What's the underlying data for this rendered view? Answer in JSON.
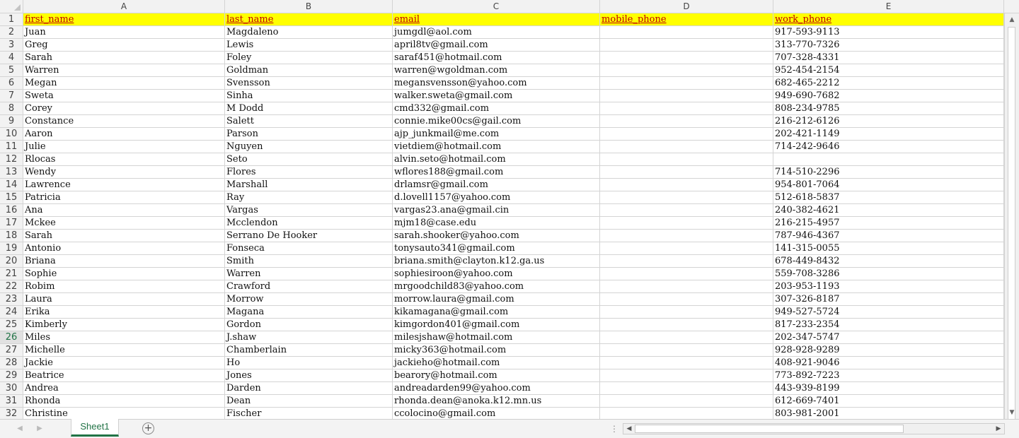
{
  "sheet": {
    "columns": [
      "A",
      "B",
      "C",
      "D",
      "E"
    ],
    "headers": [
      "first_name",
      "last_name",
      "email",
      "mobile_phone",
      "work_phone"
    ],
    "active_row": 26,
    "rows": [
      {
        "num": 1
      },
      {
        "num": 2,
        "cells": [
          "Juan",
          "Magdaleno",
          "jumgdl@aol.com",
          "",
          "917-593-9113"
        ]
      },
      {
        "num": 3,
        "cells": [
          "Greg",
          "Lewis",
          "april8tv@gmail.com",
          "",
          "313-770-7326"
        ]
      },
      {
        "num": 4,
        "cells": [
          "Sarah",
          "Foley",
          "saraf451@hotmail.com",
          "",
          "707-328-4331"
        ]
      },
      {
        "num": 5,
        "cells": [
          "Warren",
          "Goldman",
          "warren@wgoldman.com",
          "",
          "952-454-2154"
        ]
      },
      {
        "num": 6,
        "cells": [
          "Megan",
          "Svensson",
          "megansvensson@yahoo.com",
          "",
          "682-465-2212"
        ]
      },
      {
        "num": 7,
        "cells": [
          "Sweta",
          "Sinha",
          "walker.sweta@gmail.com",
          "",
          "949-690-7682"
        ]
      },
      {
        "num": 8,
        "cells": [
          "Corey",
          "M Dodd",
          "cmd332@gmail.com",
          "",
          "808-234-9785"
        ]
      },
      {
        "num": 9,
        "cells": [
          "Constance",
          "Salett",
          "connie.mike00cs@gail.com",
          "",
          "216-212-6126"
        ]
      },
      {
        "num": 10,
        "cells": [
          "Aaron",
          "Parson",
          "ajp_junkmail@me.com",
          "",
          "202-421-1149"
        ]
      },
      {
        "num": 11,
        "cells": [
          "Julie",
          "Nguyen",
          "vietdiem@hotmail.com",
          "",
          "714-242-9646"
        ]
      },
      {
        "num": 12,
        "cells": [
          "Rlocas",
          "Seto",
          "alvin.seto@hotmail.com",
          "",
          ""
        ]
      },
      {
        "num": 13,
        "cells": [
          "Wendy",
          "Flores",
          "wflores188@gmail.com",
          "",
          "714-510-2296"
        ]
      },
      {
        "num": 14,
        "cells": [
          "Lawrence",
          "Marshall",
          "drlamsr@gmail.com",
          "",
          "954-801-7064"
        ]
      },
      {
        "num": 15,
        "cells": [
          "Patricia",
          "Ray",
          "d.lovell1157@yahoo.com",
          "",
          "512-618-5837"
        ]
      },
      {
        "num": 16,
        "cells": [
          "Ana",
          "Vargas",
          "vargas23.ana@gmail.cin",
          "",
          "240-382-4621"
        ]
      },
      {
        "num": 17,
        "cells": [
          "Mckee",
          "Mcclendon",
          "mjm18@case.edu",
          "",
          "216-215-4957"
        ]
      },
      {
        "num": 18,
        "cells": [
          "Sarah",
          "Serrano De Hooker",
          "sarah.shooker@yahoo.com",
          "",
          "787-946-4367"
        ]
      },
      {
        "num": 19,
        "cells": [
          "Antonio",
          "Fonseca",
          "tonysauto341@gmail.com",
          "",
          "141-315-0055"
        ]
      },
      {
        "num": 20,
        "cells": [
          "Briana",
          "Smith",
          "briana.smith@clayton.k12.ga.us",
          "",
          "678-449-8432"
        ]
      },
      {
        "num": 21,
        "cells": [
          "Sophie",
          "Warren",
          "sophiesiroon@yahoo.com",
          "",
          "559-708-3286"
        ]
      },
      {
        "num": 22,
        "cells": [
          "Robim",
          "Crawford",
          "mrgoodchild83@yahoo.com",
          "",
          "203-953-1193"
        ]
      },
      {
        "num": 23,
        "cells": [
          "Laura",
          "Morrow",
          "morrow.laura@gmail.com",
          "",
          "307-326-8187"
        ]
      },
      {
        "num": 24,
        "cells": [
          "Erika",
          "Magana",
          "kikamagana@gmail.com",
          "",
          "949-527-5724"
        ]
      },
      {
        "num": 25,
        "cells": [
          "Kimberly",
          "Gordon",
          "kimgordon401@gmail.com",
          "",
          "817-233-2354"
        ]
      },
      {
        "num": 26,
        "cells": [
          "Miles",
          "J.shaw",
          "milesjshaw@hotmail.com",
          "",
          "202-347-5747"
        ]
      },
      {
        "num": 27,
        "cells": [
          "Michelle",
          "Chamberlain",
          "micky363@hotmail.com",
          "",
          "928-928-9289"
        ]
      },
      {
        "num": 28,
        "cells": [
          "Jackie",
          "Ho",
          "jackieho@hotmail.com",
          "",
          "408-921-9046"
        ]
      },
      {
        "num": 29,
        "cells": [
          "Beatrice",
          "Jones",
          "bearory@hotmail.com",
          "",
          "773-892-7223"
        ]
      },
      {
        "num": 30,
        "cells": [
          "Andrea",
          "Darden",
          "andreadarden99@yahoo.com",
          "",
          "443-939-8199"
        ]
      },
      {
        "num": 31,
        "cells": [
          "Rhonda",
          "Dean",
          "rhonda.dean@anoka.k12.mn.us",
          "",
          "612-669-7401"
        ]
      },
      {
        "num": 32,
        "cells": [
          "Christine",
          "Fischer",
          "ccolocino@gmail.com",
          "",
          "803-981-2001"
        ]
      }
    ]
  },
  "tabs": {
    "sheet_name": "Sheet1",
    "add_icon": "plus-circle-icon"
  },
  "colors": {
    "header_fill": "#ffff00",
    "header_text": "#c00000",
    "accent": "#217346"
  }
}
